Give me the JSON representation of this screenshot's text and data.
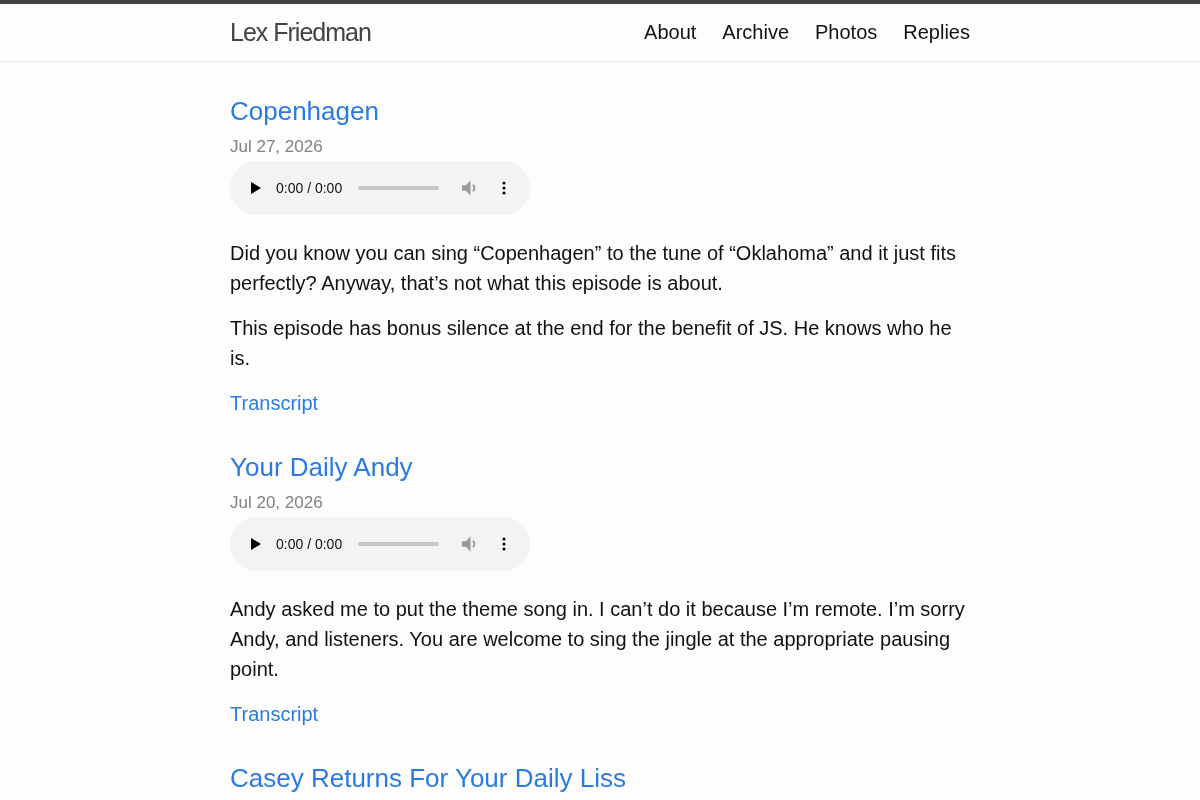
{
  "header": {
    "site_title": "Lex Friedman",
    "nav": [
      "About",
      "Archive",
      "Photos",
      "Replies"
    ]
  },
  "posts": [
    {
      "title": "Copenhagen",
      "date": "Jul 27, 2026",
      "audio": {
        "time": "0:00 / 0:00",
        "level": 0
      },
      "paragraphs": [
        "Did you know you can sing “Copenhagen” to the tune of “Oklahoma” and it just fits perfectly? Anyway, that’s not what this episode is about.",
        "This episode has bonus silence at the end for the benefit of JS. He knows who he is."
      ],
      "link": "Transcript"
    },
    {
      "title": "Your Daily Andy",
      "date": "Jul 20, 2026",
      "audio": {
        "time": "0:00 / 0:00",
        "level": 0
      },
      "paragraphs": [
        "Andy asked me to put the theme song in. I can’t do it because I’m remote. I’m sorry Andy, and listeners. You are welcome to sing the jingle at the appropriate pausing point."
      ],
      "link": "Transcript"
    },
    {
      "title": "Casey Returns For Your Daily Liss"
    }
  ]
}
